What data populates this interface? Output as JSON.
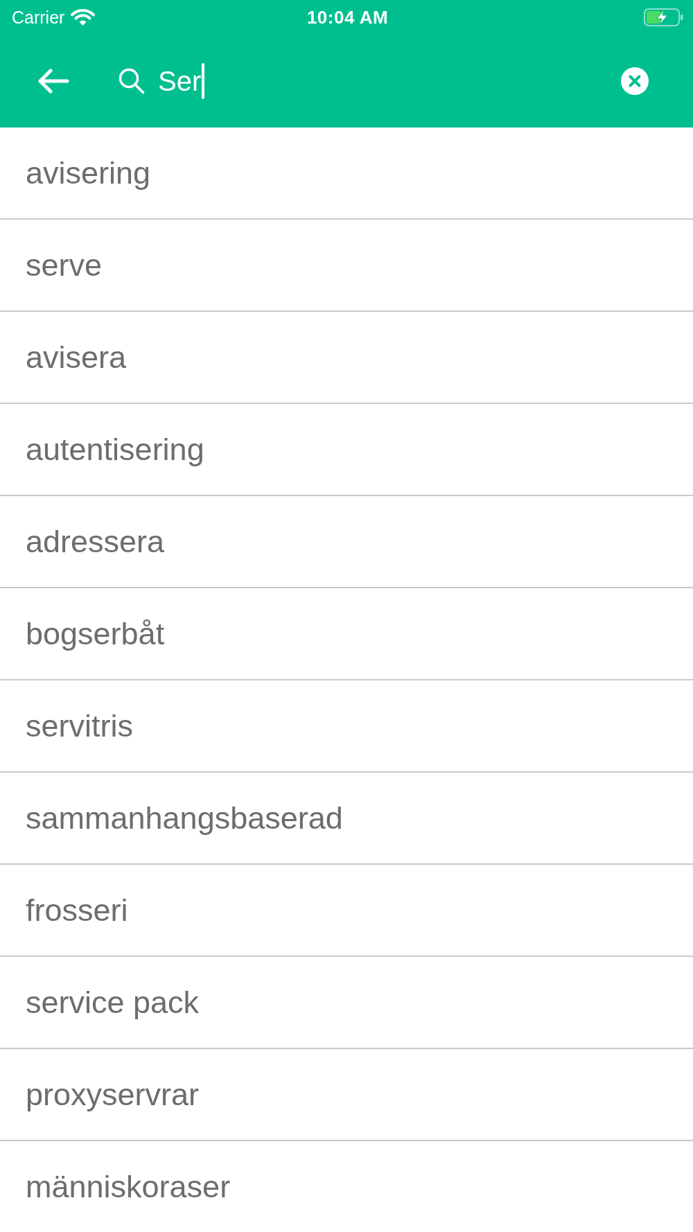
{
  "status_bar": {
    "carrier": "Carrier",
    "time": "10:04 AM"
  },
  "search": {
    "value": "Ser"
  },
  "results": [
    "avisering",
    "serve",
    "avisera",
    "autentisering",
    "adressera",
    "bogserbåt",
    "servitris",
    "sammanhangsbaserad",
    "frosseri",
    "service pack",
    "proxyservrar",
    "människoraser"
  ]
}
